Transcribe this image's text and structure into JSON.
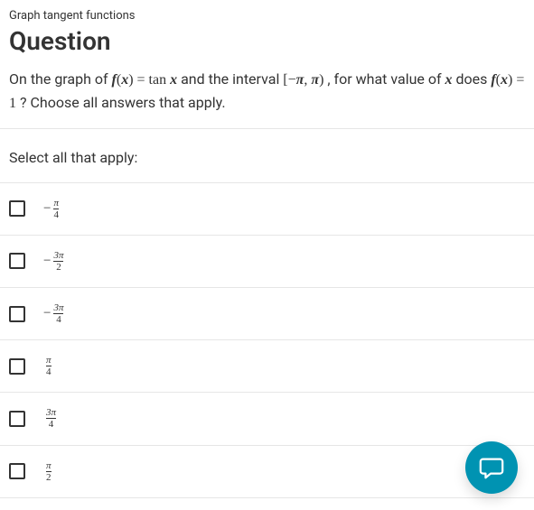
{
  "breadcrumb": "Graph tangent functions",
  "title": "Question",
  "prompt": {
    "pre": "On the graph of ",
    "fx_eq_tanx": "f(x) = tan x",
    "mid1": " and the interval ",
    "interval": "[−π, π)",
    "mid2": ", for what value of ",
    "x": "x",
    "mid3": " does ",
    "fx_eq_1": "f(x) = 1",
    "post": "? Choose all answers that apply."
  },
  "select_label": "Select all that apply:",
  "options": [
    {
      "neg": "−",
      "num": "π",
      "den": "4"
    },
    {
      "neg": "−",
      "num": "3π",
      "den": "2"
    },
    {
      "neg": "−",
      "num": "3π",
      "den": "4"
    },
    {
      "neg": "",
      "num": "π",
      "den": "4"
    },
    {
      "neg": "",
      "num": "3π",
      "den": "4"
    },
    {
      "neg": "",
      "num": "π",
      "den": "2"
    }
  ],
  "icons": {
    "chat": "chat-icon"
  }
}
